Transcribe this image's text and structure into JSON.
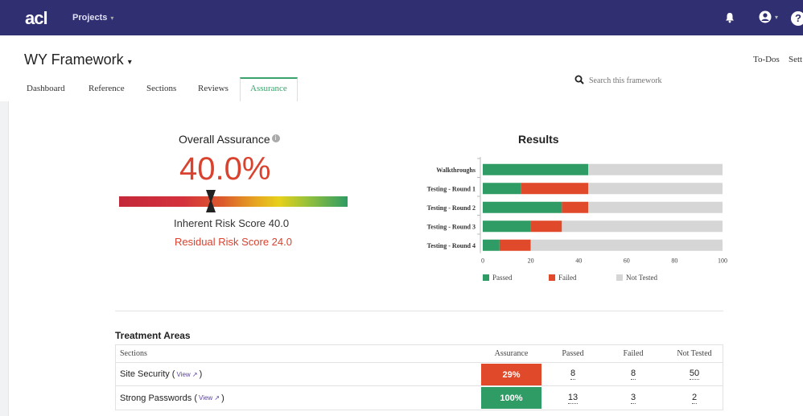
{
  "app": {
    "logo": "acl",
    "nav_projects": "Projects",
    "colors": {
      "topbar": "#302f72",
      "accent_green": "#3aa36c",
      "risk_red": "#d9422e"
    },
    "icons": {
      "notifications": "bell-icon",
      "user": "user-icon",
      "help": "help-icon"
    }
  },
  "header": {
    "framework_title": "WY Framework",
    "todos_label": "To-Dos",
    "settings_label": "Sett",
    "search_placeholder": "Search this framework",
    "tabs": [
      {
        "label": "Dashboard",
        "active": false
      },
      {
        "label": "Reference",
        "active": false
      },
      {
        "label": "Sections",
        "active": false
      },
      {
        "label": "Reviews",
        "active": false
      },
      {
        "label": "Assurance",
        "active": true
      }
    ]
  },
  "overall": {
    "title": "Overall Assurance",
    "value": "40.0%",
    "gauge_position": 0.4,
    "inherent": "Inherent Risk Score 40.0",
    "residual": "Residual Risk Score 24.0"
  },
  "results": {
    "title": "Results"
  },
  "chart_data": {
    "type": "bar",
    "orientation": "horizontal",
    "stacked": true,
    "title": "Results",
    "categories": [
      "Walkthroughs",
      "Testing - Round 1",
      "Testing - Round 2",
      "Testing - Round 3",
      "Testing - Round 4"
    ],
    "series": [
      {
        "name": "Passed",
        "color": "#2e9c64",
        "values": [
          44,
          16,
          33,
          20,
          7
        ]
      },
      {
        "name": "Failed",
        "color": "#e04a2a",
        "values": [
          0,
          28,
          11,
          13,
          13
        ]
      },
      {
        "name": "Not Tested",
        "color": "#d6d6d6",
        "values": [
          56,
          56,
          56,
          67,
          80
        ]
      }
    ],
    "xlim": [
      0,
      100
    ],
    "xticks": [
      "0",
      "20",
      "40",
      "60",
      "80",
      "100"
    ],
    "legend": "bottom"
  },
  "treatment": {
    "title": "Treatment Areas",
    "columns": [
      "Sections",
      "Assurance",
      "Passed",
      "Failed",
      "Not Tested"
    ],
    "view_label": "View ↗",
    "rows": [
      {
        "section": "Site Security",
        "assurance": "29%",
        "assurance_color": "#e04a2a",
        "passed": "8",
        "failed": "8",
        "not_tested": "50"
      },
      {
        "section": "Strong Passwords",
        "assurance": "100%",
        "assurance_color": "#2e9c64",
        "passed": "13",
        "failed": "3",
        "not_tested": "2"
      }
    ]
  }
}
